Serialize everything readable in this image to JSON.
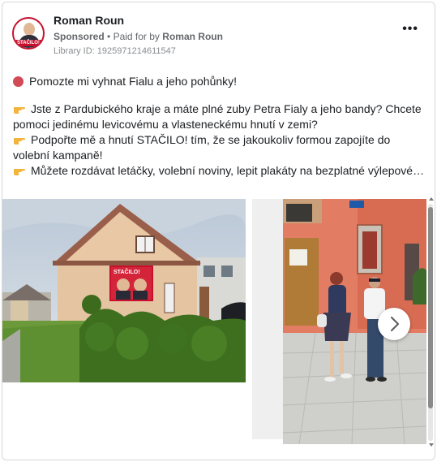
{
  "post": {
    "author": "Roman Roun",
    "avatar_band_text": "STAČILO!",
    "sponsored": "Sponsored",
    "separator": "•",
    "paid_for_by_label": "Paid for by",
    "paid_for_by_name": "Roman Roun",
    "library_id": "Library ID: 1925971214611547",
    "more_icon": "more-horizontal-icon",
    "lines": [
      "Pomozte mi vyhnat Fialu a jeho pohůnky!",
      "Jste z Pardubického kraje a máte plné zuby Petra Fialy a jeho bandy? Chcete pomoci jedinému levicovému a vlasteneckému hnutí v zemi?",
      "Podpořte mě a hnutí STAČILO! tím, že se jakoukoliv formou zapojíte do volební kampaně!",
      "Můžete rozdávat letáčky, volební noviny, lepit plakáty na bezplatné výlepové…"
    ]
  },
  "media": {
    "billboard_text": "STAČILO!",
    "street_sign": "",
    "next_icon": "chevron-right-icon"
  },
  "colors": {
    "brand_red": "#c8102e",
    "text": "#1c1e21",
    "secondary": "#65676b"
  }
}
